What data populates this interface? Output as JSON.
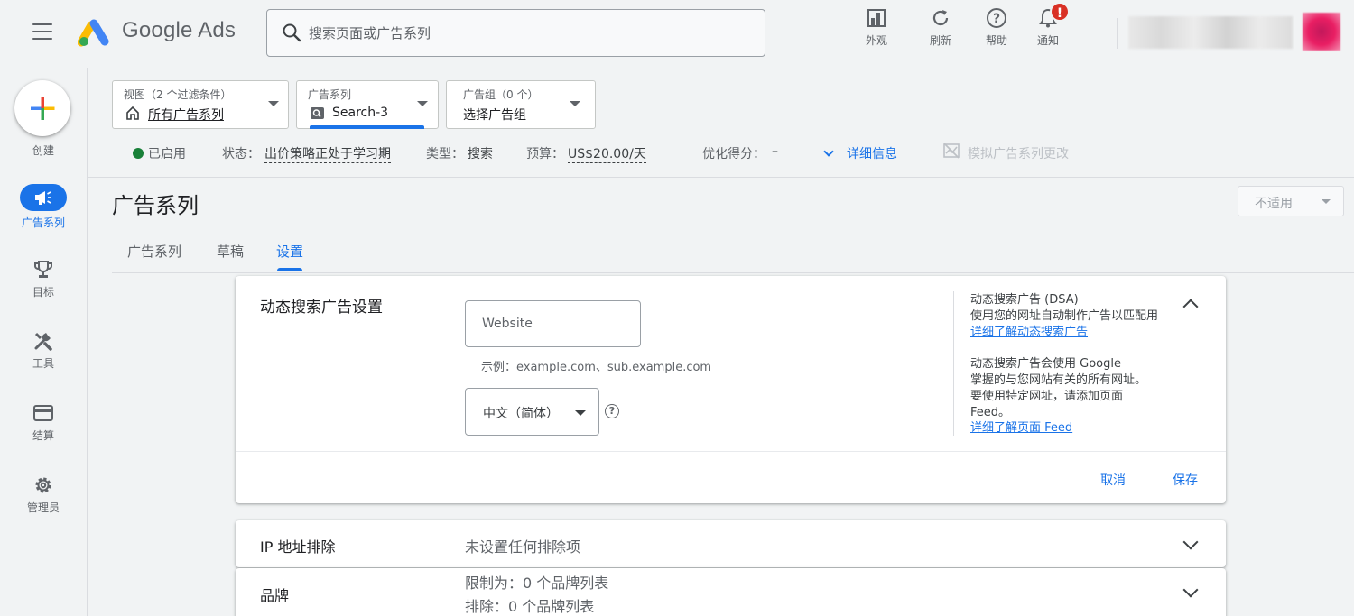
{
  "header": {
    "app_name": "Google Ads",
    "search_placeholder": "搜索页面或广告系列",
    "actions": [
      {
        "label": "外观",
        "icon": "appearance-icon"
      },
      {
        "label": "刷新",
        "icon": "refresh-icon"
      },
      {
        "label": "帮助",
        "icon": "help-icon"
      },
      {
        "label": "通知",
        "icon": "bell-icon"
      }
    ],
    "notification_badge": "!"
  },
  "rail": {
    "create_label": "创建",
    "items": [
      {
        "label": "广告系列",
        "icon": "megaphone-icon",
        "active": true
      },
      {
        "label": "目标",
        "icon": "trophy-icon"
      },
      {
        "label": "工具",
        "icon": "tools-icon"
      },
      {
        "label": "结算",
        "icon": "credit-card-icon"
      },
      {
        "label": "管理员",
        "icon": "gear-icon"
      }
    ]
  },
  "filters": {
    "view": {
      "caption": "视图（2 个过滤条件）",
      "value": "所有广告系列"
    },
    "campaign": {
      "caption": "广告系列",
      "value": "Search-3"
    },
    "adgroup": {
      "caption": "广告组（0 个）",
      "value": "选择广告组"
    }
  },
  "status_bar": {
    "enabled": "已启用",
    "status_label": "状态：",
    "status_value": "出价策略正处于学习期",
    "type_label": "类型：",
    "type_value": "搜索",
    "budget_label": "预算：",
    "budget_value": "US$20.00/天",
    "score_label": "优化得分：",
    "score_value": "–",
    "details": "详细信息",
    "simulate": "模拟广告系列更改"
  },
  "page": {
    "title": "广告系列",
    "na_select": "不适用",
    "tabs": [
      "广告系列",
      "草稿",
      "设置"
    ],
    "active_tab": "设置"
  },
  "dsa_card": {
    "title": "动态搜索广告设置",
    "website_placeholder": "Website",
    "hint": "示例：example.com、sub.example.com",
    "language": "中文（简体）",
    "side_title": "动态搜索广告 (DSA)",
    "side_desc": "使用您的网址自动制作广告以匹配用",
    "side_link1": "详细了解动态搜索广告",
    "side_p2": [
      "动态搜索广告会使用 Google",
      "掌握的与您网站有关的所有网址。",
      "要使用特定网址，请添加页面",
      "Feed。"
    ],
    "side_link2": "详细了解页面 Feed",
    "cancel": "取消",
    "save": "保存"
  },
  "ip_card": {
    "title": "IP 地址排除",
    "value": "未设置任何排除项"
  },
  "brand_card": {
    "title": "品牌",
    "values": [
      "限制为：0 个品牌列表",
      "排除：0 个品牌列表"
    ]
  }
}
